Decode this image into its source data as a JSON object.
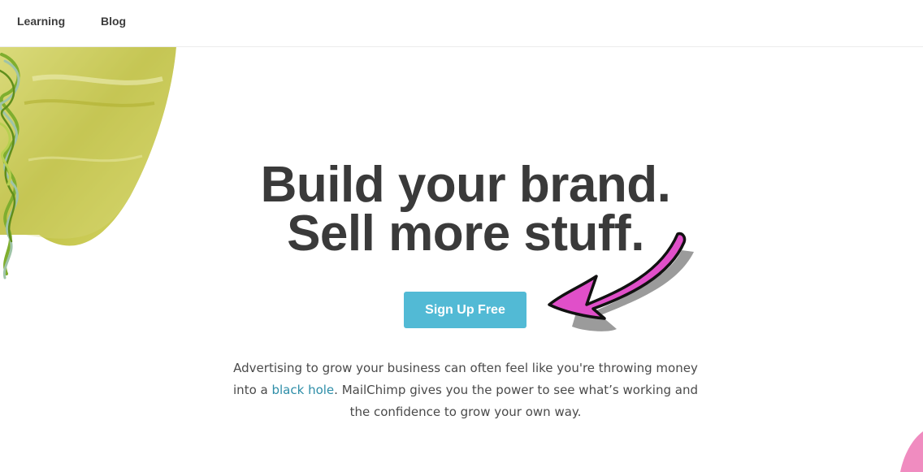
{
  "nav": {
    "items": [
      {
        "label": "Learning"
      },
      {
        "label": "Blog"
      }
    ]
  },
  "hero": {
    "headline_line1": "Build your brand.",
    "headline_line2": "Sell more stuff.",
    "cta_label": "Sign Up Free",
    "body_part1": "Advertising to grow your business can often feel like you're throwing money into a ",
    "body_link": "black hole",
    "body_part2": ". MailChimp gives you the power to see what’s working and the confidence to grow your own way."
  },
  "colors": {
    "cta_background": "#52bad5",
    "link": "#2e8ea8",
    "heading": "#3a3a3a",
    "annotation_arrow": "#e04fc9",
    "art_yellow_green": "#c9cc5a",
    "decor_pink": "#f08cc0"
  },
  "icons": {
    "annotation": "hand-drawn-arrow-icon"
  }
}
